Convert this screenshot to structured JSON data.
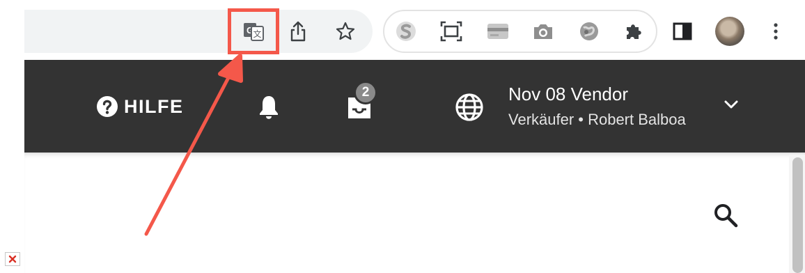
{
  "browser_toolbar": {
    "icons": [
      "google-translate-icon",
      "share-icon",
      "bookmark-star-icon",
      "extension-s-icon",
      "screenshot-frame-icon",
      "card-extension-icon",
      "camera-icon",
      "globe-extension-icon",
      "extensions-puzzle-icon",
      "side-panel-icon",
      "profile-avatar",
      "more-menu-icon"
    ]
  },
  "header": {
    "help_label": "HILFE",
    "notifications_icon": "bell-icon",
    "inbox": {
      "icon": "inbox-icon",
      "badge_count": "2"
    },
    "account": {
      "icon": "globe-icon",
      "title": "Nov 08 Vendor",
      "subtitle": "Verkäufer • Robert Balboa",
      "chevron": "chevron-down-icon"
    }
  },
  "content": {
    "search_icon": "search-icon"
  },
  "annotation": {
    "color": "#f4584a",
    "target": "google-translate-icon"
  },
  "colors": {
    "header_bg": "#333333",
    "accent_red": "#f4584a"
  }
}
